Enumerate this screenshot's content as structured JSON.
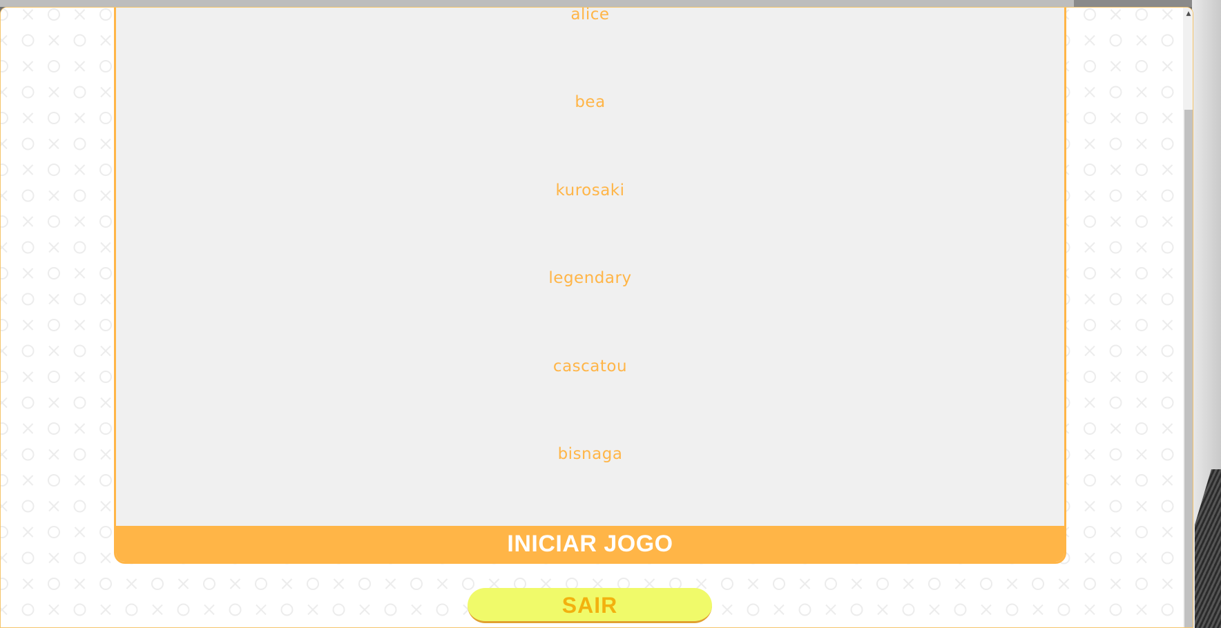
{
  "players": [
    "alice",
    "bea",
    "kurosaki",
    "legendary",
    "cascatou",
    "bisnaga"
  ],
  "start_button": {
    "label": "INICIAR JOGO"
  },
  "exit_button": {
    "label": "SAIR"
  },
  "scrollbar": {
    "up_arrow_glyph": "▲"
  },
  "colors": {
    "accent": "#ffb547",
    "panel_bg": "#f0f0f0",
    "exit_bg": "#f0fa6a",
    "exit_text": "#f2b10f",
    "pattern": "#ececec"
  },
  "icons": {
    "background_pattern": "tic-tac-toe-x-o-pattern"
  }
}
